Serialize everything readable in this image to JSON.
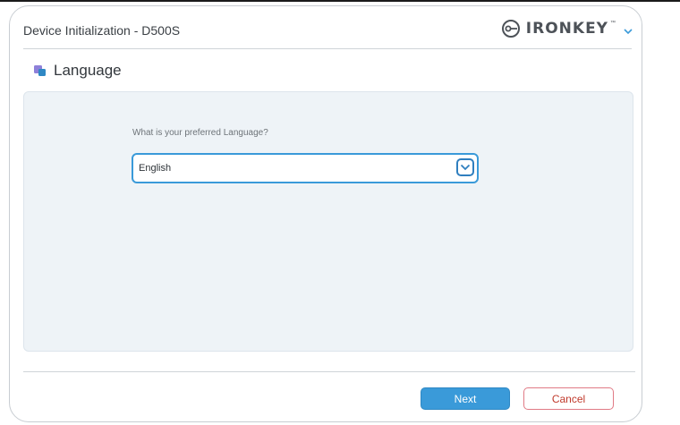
{
  "window": {
    "title": "Device Initialization - D500S",
    "brand": "IRONKEY",
    "brand_tm": "™"
  },
  "section": {
    "title": "Language",
    "icon": "language-squares-icon"
  },
  "form": {
    "question": "What is your preferred Language?",
    "language_select": {
      "value": "English"
    }
  },
  "buttons": {
    "next": "Next",
    "cancel": "Cancel"
  },
  "colors": {
    "accent": "#3a9ad9",
    "cancel": "#c0392b",
    "panel_bg": "#eef3f7"
  }
}
